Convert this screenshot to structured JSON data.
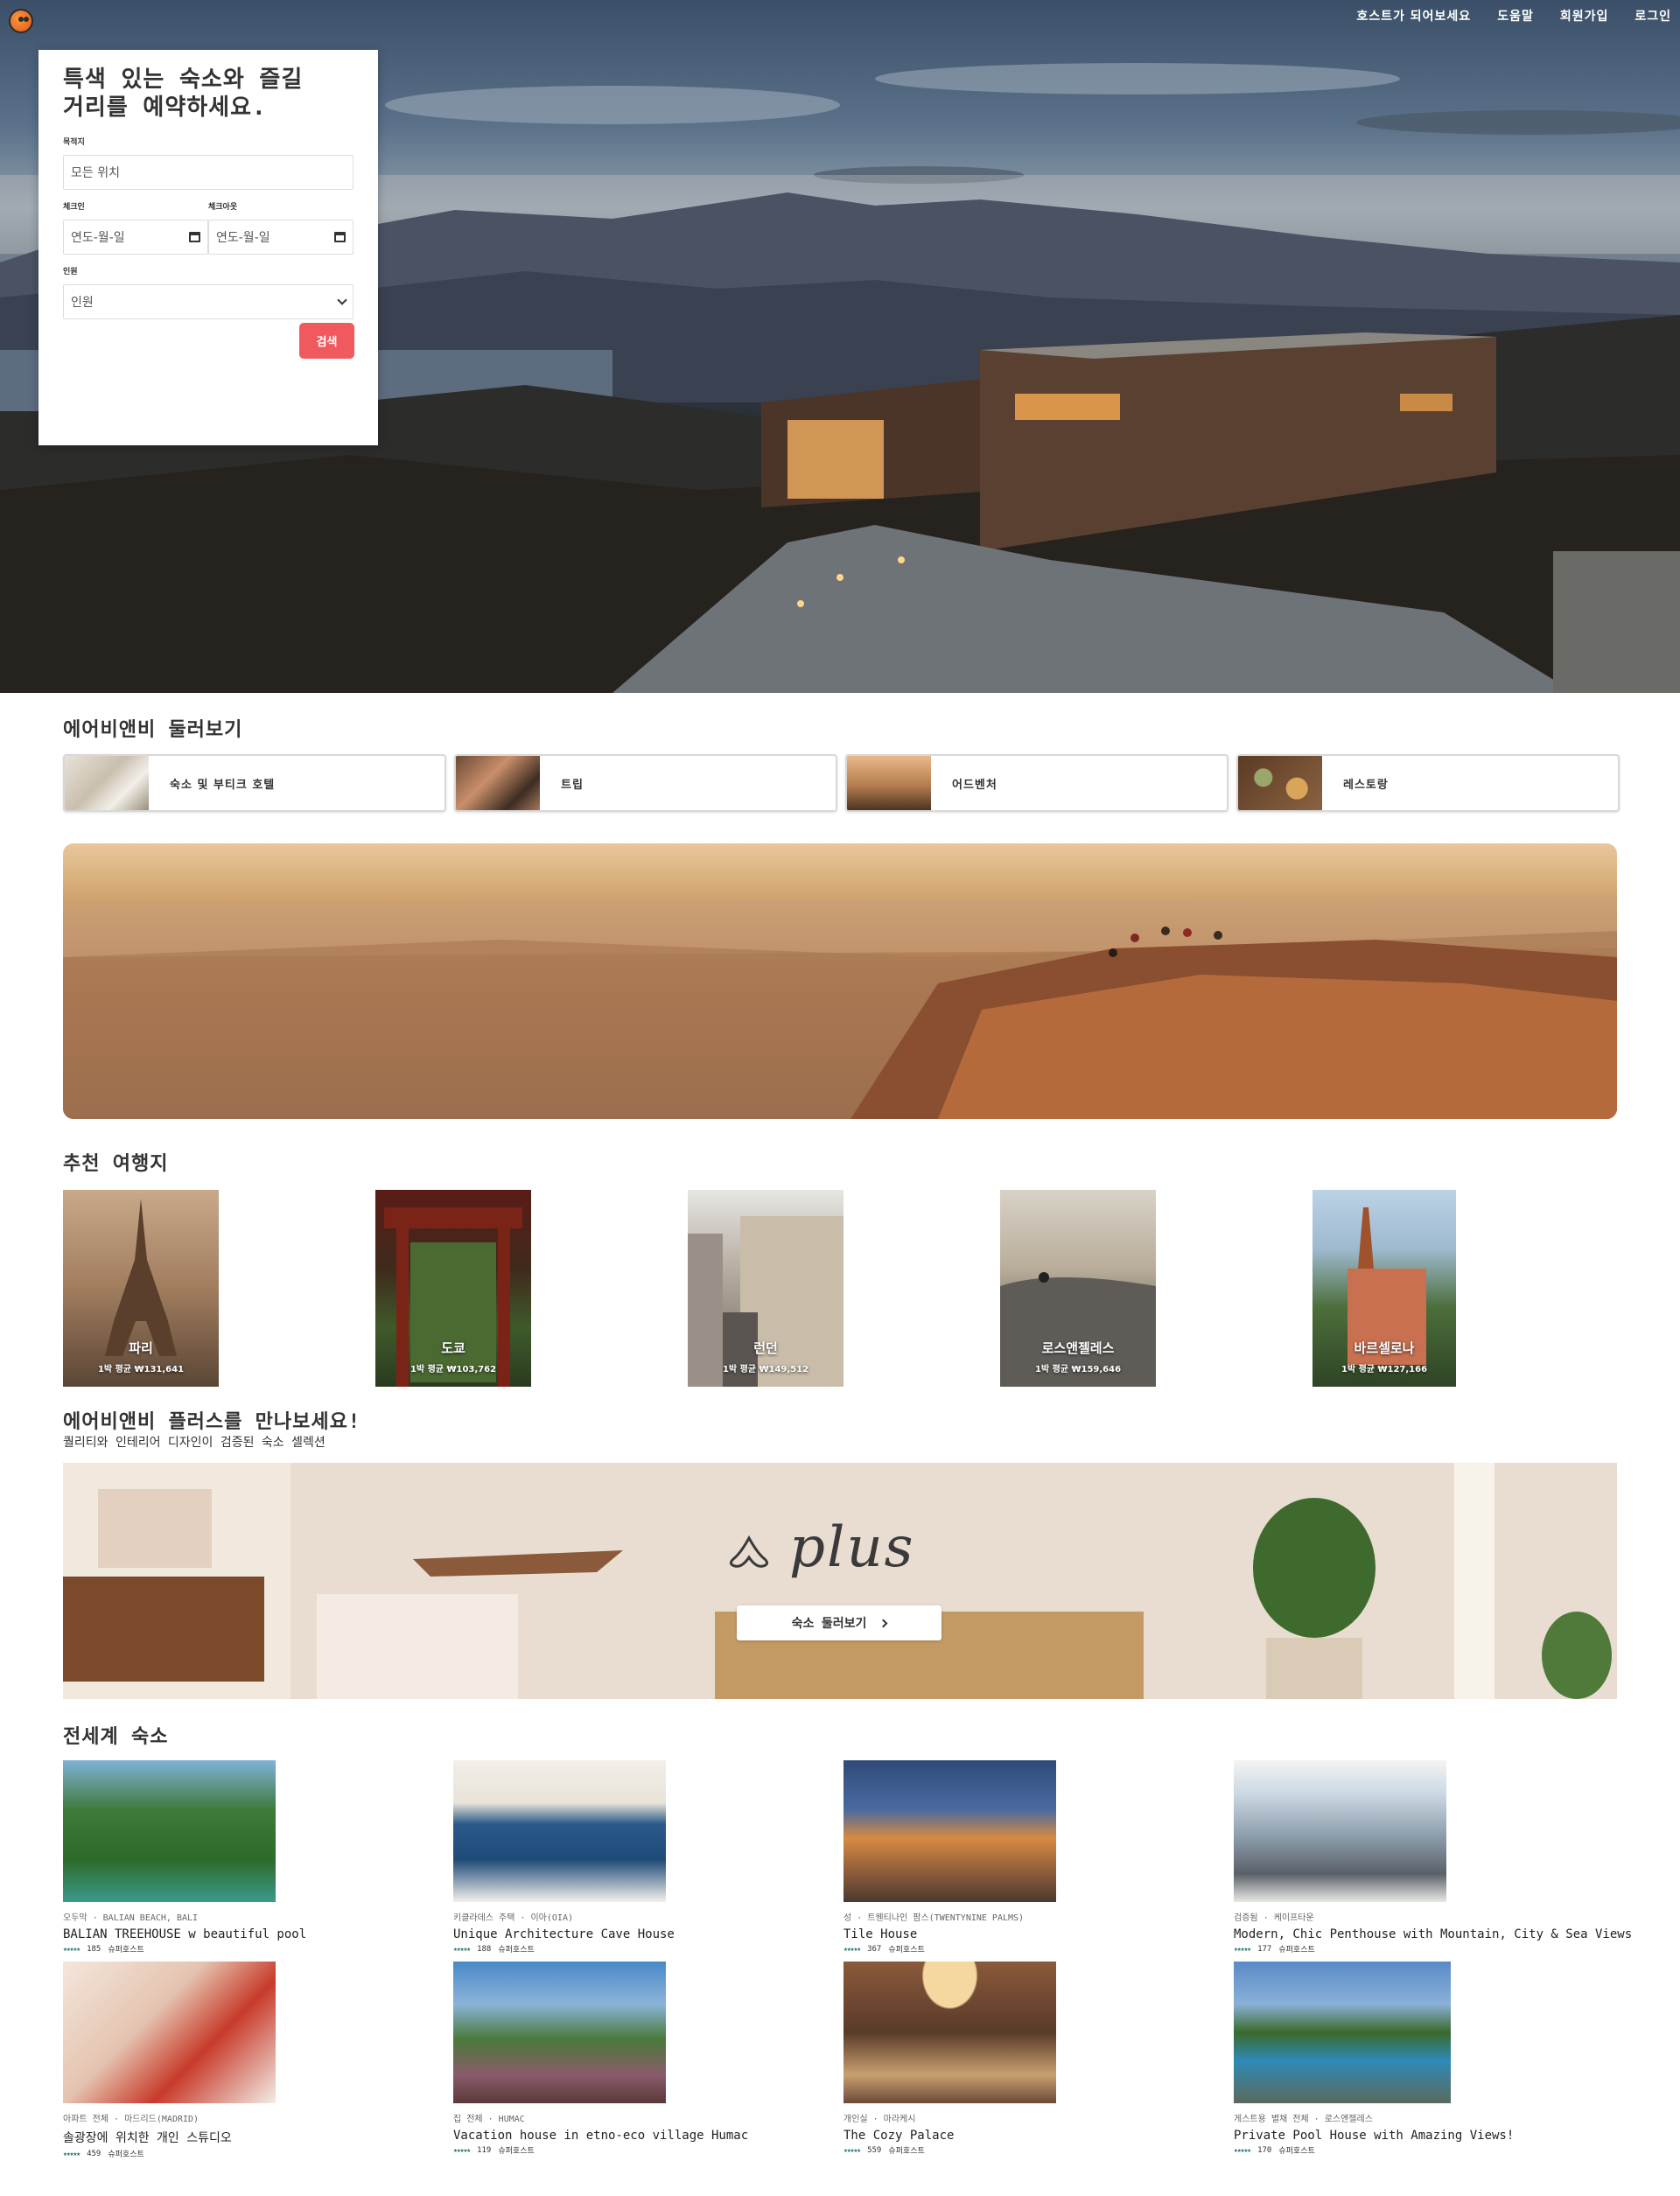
{
  "header": {
    "nav": [
      "호스트가 되어보세요",
      "도움말",
      "회원가입",
      "로그인"
    ]
  },
  "search": {
    "title_line1": "특색 있는 숙소와 즐길",
    "title_line2": "거리를 예약하세요.",
    "destination_label": "목적지",
    "destination_placeholder": "모든 위치",
    "checkin_label": "체크인",
    "checkout_label": "체크아웃",
    "date_placeholder": "연도-월-일",
    "guests_label": "인원",
    "guests_value": "인원",
    "button": "검색"
  },
  "explore": {
    "title": "에어비앤비 둘러보기",
    "categories": [
      "숙소 및 부티크 호텔",
      "트립",
      "어드벤처",
      "레스토랑"
    ]
  },
  "recommended": {
    "title": "추천 여행지",
    "destinations": [
      {
        "name": "파리",
        "price": "1박 평균 ₩131,641"
      },
      {
        "name": "도쿄",
        "price": "1박 평균 ₩103,762"
      },
      {
        "name": "런던",
        "price": "1박 평균 ₩149,512"
      },
      {
        "name": "로스앤젤레스",
        "price": "1박 평균 ₩159,646"
      },
      {
        "name": "바르셀로나",
        "price": "1박 평균 ₩127,166"
      }
    ]
  },
  "plus": {
    "title": "에어비앤비 플러스를 만나보세요!",
    "subtitle": "퀄리티와 인테리어 디자인이 검증된 숙소 셀렉션",
    "wordmark": "plus",
    "button": "숙소 둘러보기"
  },
  "worldwide": {
    "title": "전세계 숙소",
    "listings": [
      {
        "meta": "오두막 · BALIAN BEACH, BALI",
        "title": "BALIAN TREEHOUSE w beautiful pool",
        "stars": "★★★★★",
        "count": "185",
        "badge": "슈퍼호스트"
      },
      {
        "meta": "키클라데스 주택 · 이아(OIA)",
        "title": "Unique Architecture Cave House",
        "stars": "★★★★★",
        "count": "188",
        "badge": "슈퍼호스트"
      },
      {
        "meta": "성 · 트웬티나인 팜스(TWENTYNINE PALMS)",
        "title": "Tile House",
        "stars": "★★★★★",
        "count": "367",
        "badge": "슈퍼호스트"
      },
      {
        "meta": "검증됨 · 케이프타운",
        "title": "Modern, Chic Penthouse with Mountain, City & Sea Views",
        "stars": "★★★★★",
        "count": "177",
        "badge": "슈퍼호스트"
      },
      {
        "meta": "아파트 전체 · 마드리드(MADRID)",
        "title": "솔광장에 위치한 개인 스튜디오",
        "stars": "★★★★★",
        "count": "459",
        "badge": "슈퍼호스트"
      },
      {
        "meta": "집 전체 · HUMAC",
        "title": "Vacation house in etno-eco village Humac",
        "stars": "★★★★★",
        "count": "119",
        "badge": "슈퍼호스트"
      },
      {
        "meta": "개인실 · 마라케시",
        "title": "The Cozy Palace",
        "stars": "★★★★★",
        "count": "559",
        "badge": "슈퍼호스트"
      },
      {
        "meta": "게스트용 별채 전체 · 로스앤젤레스",
        "title": "Private Pool House with Amazing Views!",
        "stars": "★★★★★",
        "count": "170",
        "badge": "슈퍼호스트"
      }
    ]
  }
}
